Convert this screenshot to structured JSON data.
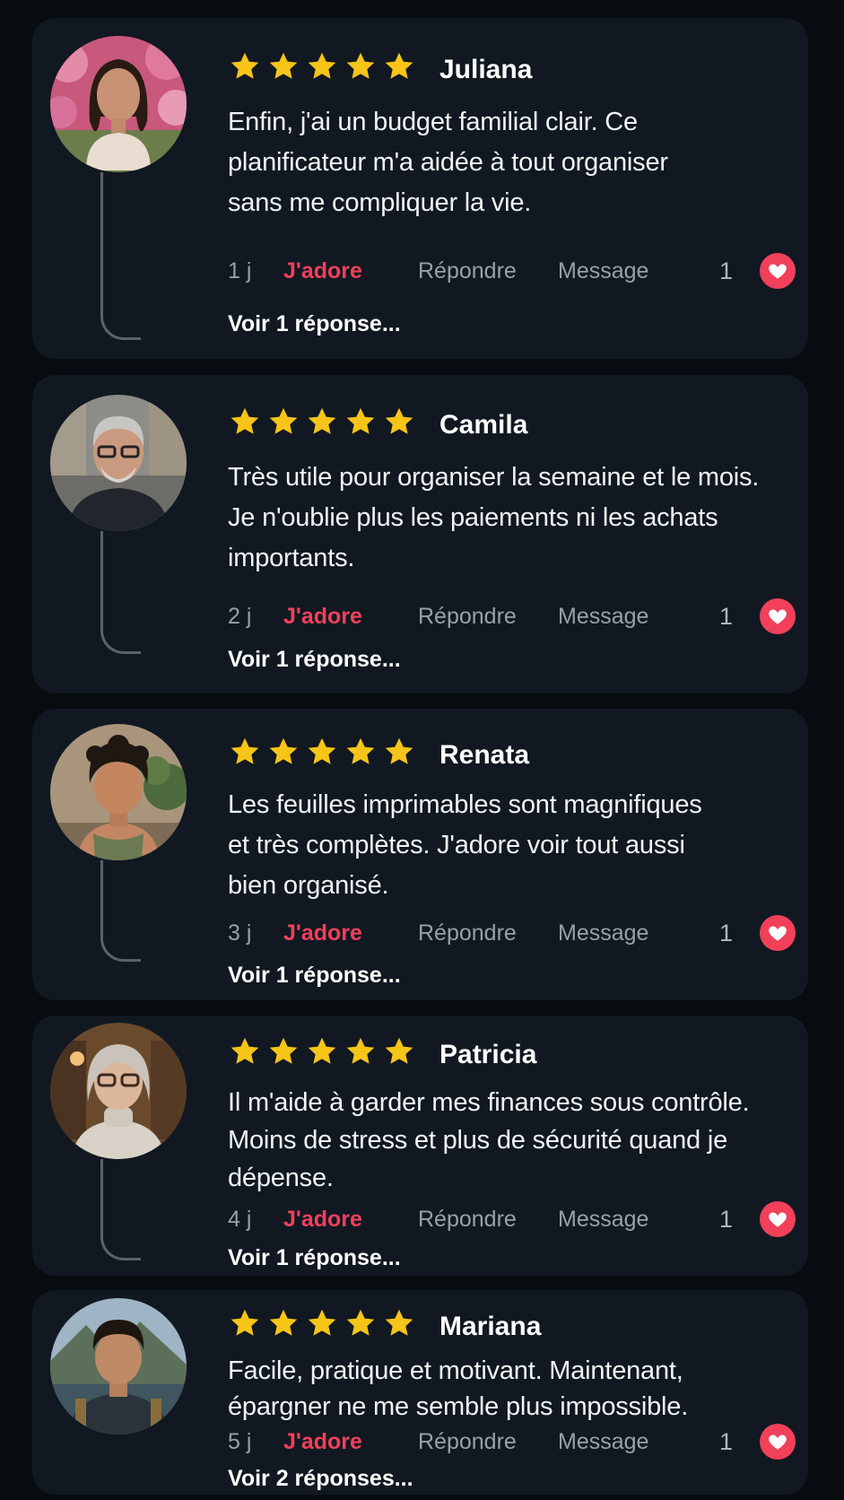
{
  "colors": {
    "background": "#080b10",
    "card": "#111821",
    "star": "#f7c418",
    "accent": "#f0405a",
    "muted": "#9aa0a8"
  },
  "icons": {
    "rating": "star-icon",
    "like": "heart-icon"
  },
  "reviews": [
    {
      "name": "Juliana",
      "rating": 5,
      "text": "Enfin, j'ai un budget familial clair. Ce planificateur m'a aidée à tout organiser sans me compliquer la vie.",
      "time": "1 j",
      "love_label": "J'adore",
      "reply_label": "Répondre",
      "message_label": "Message",
      "likes": "1",
      "replies_label": "Voir 1 réponse..."
    },
    {
      "name": "Camila",
      "rating": 5,
      "text": "Très utile pour organiser la semaine et le mois. Je n'oublie plus les paiements ni les achats importants.",
      "time": "2 j",
      "love_label": "J'adore",
      "reply_label": "Répondre",
      "message_label": "Message",
      "likes": "1",
      "replies_label": "Voir 1 réponse..."
    },
    {
      "name": "Renata",
      "rating": 5,
      "text": "Les feuilles imprimables sont magnifiques et très complètes. J'adore voir tout aussi bien organisé.",
      "time": "3 j",
      "love_label": "J'adore",
      "reply_label": "Répondre",
      "message_label": "Message",
      "likes": "1",
      "replies_label": "Voir 1 réponse..."
    },
    {
      "name": "Patricia",
      "rating": 5,
      "text": "Il m'aide à garder mes finances sous contrôle. Moins de stress et plus de sécurité quand je dépense.",
      "time": "4 j",
      "love_label": "J'adore",
      "reply_label": "Répondre",
      "message_label": "Message",
      "likes": "1",
      "replies_label": "Voir 1 réponse..."
    },
    {
      "name": "Mariana",
      "rating": 5,
      "text": "Facile, pratique et motivant. Maintenant, épargner ne me semble plus impossible.",
      "time": "5 j",
      "love_label": "J'adore",
      "reply_label": "Répondre",
      "message_label": "Message",
      "likes": "1",
      "replies_label": "Voir 2 réponses..."
    }
  ]
}
